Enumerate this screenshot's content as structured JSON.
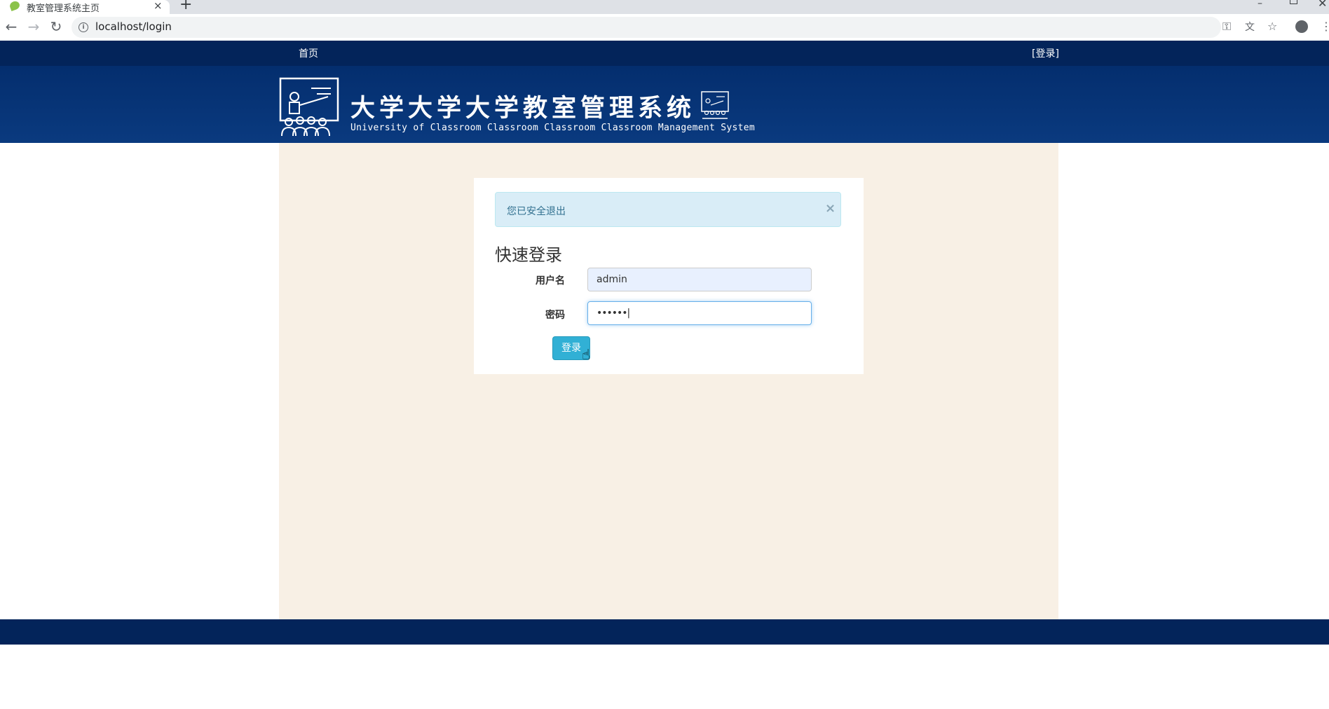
{
  "browser": {
    "tab_title": "教室管理系统主页",
    "tab_close": "×",
    "new_tab": "+",
    "url": "localhost/login",
    "window_min": "–",
    "window_close": "✕"
  },
  "site_nav": {
    "home": "首页",
    "login": "[登录]"
  },
  "header": {
    "title": "大学大学大学教室管理系统",
    "subtitle": "University of Classroom Classroom Classroom Classroom Management System"
  },
  "login": {
    "alert_text": "您已安全退出",
    "alert_close": "×",
    "title": "快速登录",
    "username_label": "用户名",
    "username_value": "admin",
    "password_label": "密码",
    "password_value": "••••••|",
    "submit_label": "登录"
  },
  "colors": {
    "nav_bg": "#03245a",
    "banner_bg": "#042e6e",
    "main_bg": "#f8f0e5",
    "button": "#31b0d5",
    "alert_bg": "#d9edf7"
  }
}
